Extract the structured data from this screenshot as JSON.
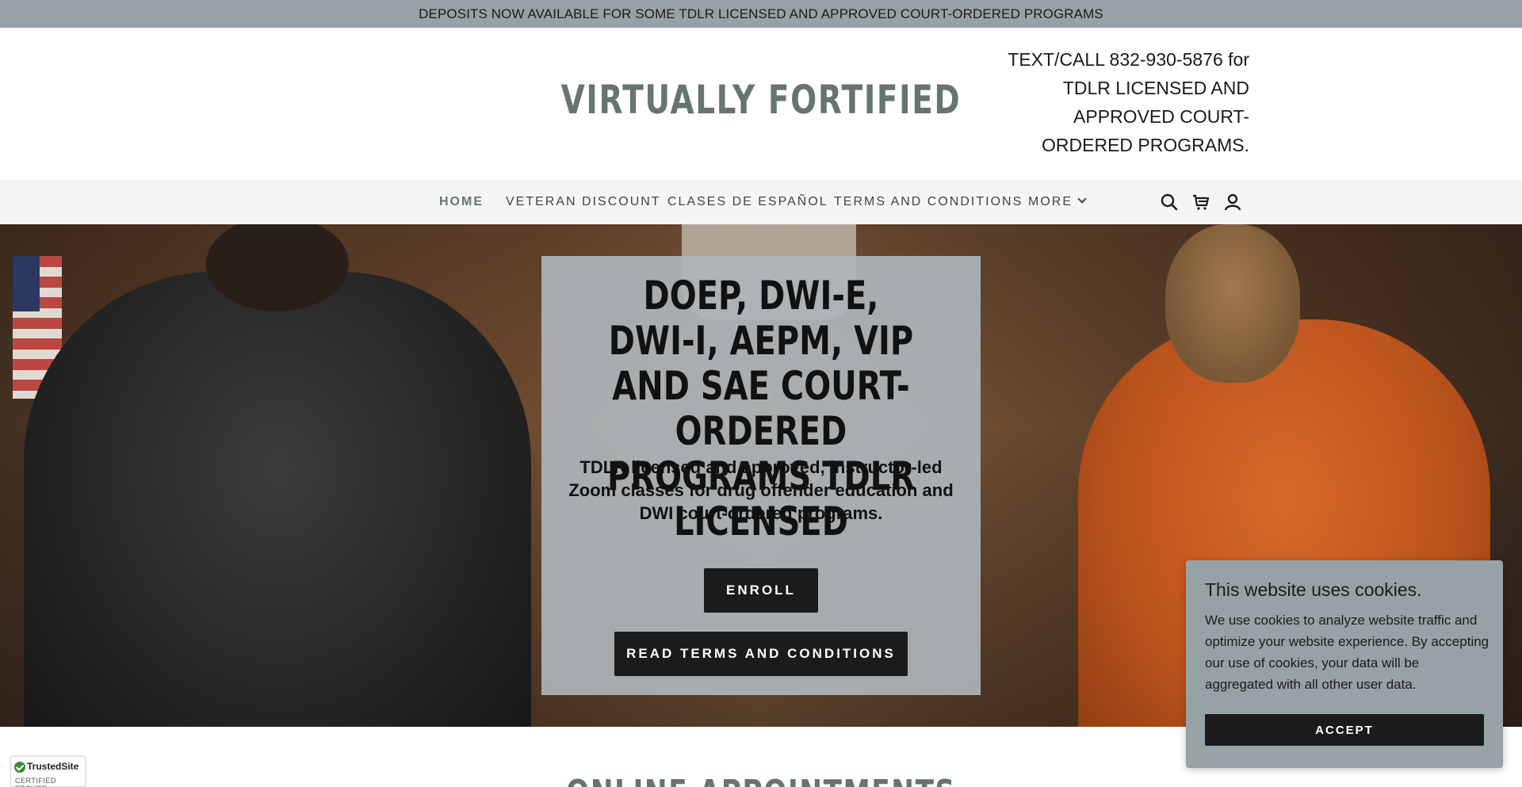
{
  "announcement": "DEPOSITS NOW AVAILABLE FOR SOME TDLR LICENSED AND APPROVED COURT-ORDERED PROGRAMS",
  "header": {
    "logo": "VIRTUALLY FORTIFIED",
    "contact": "TEXT/CALL 832-930-5876 for TDLR LICENSED AND APPROVED COURT-ORDERED PROGRAMS."
  },
  "nav": {
    "items": [
      {
        "label": "HOME",
        "active": true
      },
      {
        "label": "VETERAN DISCOUNT"
      },
      {
        "label": "CLASES DE ESPAÑOL"
      },
      {
        "label": "TERMS AND CONDITIONS"
      },
      {
        "label": "MORE"
      }
    ],
    "icons": [
      "search-icon",
      "cart-icon",
      "account-icon"
    ]
  },
  "hero": {
    "title": "DOEP, DWI-E, DWI-I, AEPM, VIP AND SAE COURT-ORDERED PROGRAMS TDLR LICENSED",
    "subtitle": "TDLR licensed and approved, instructor-led Zoom classes for drug offender education and DWI court-ordered programs.",
    "enroll_label": "ENROLL",
    "terms_label": "READ TERMS AND CONDITIONS"
  },
  "section": {
    "title": "ONLINE APPOINTMENTS"
  },
  "badge": {
    "name": "TrustedSite",
    "sub": "CERTIFIED SECURE"
  },
  "cookie": {
    "title": "This website uses cookies.",
    "text": "We use cookies to analyze website traffic and optimize your website experience. By accepting our use of cookies, your data will be aggregated with all other user data.",
    "accept_label": "ACCEPT"
  },
  "colors": {
    "announce_bg": "#97a2a6",
    "logo": "#667472",
    "button": "#1b1b1b"
  }
}
